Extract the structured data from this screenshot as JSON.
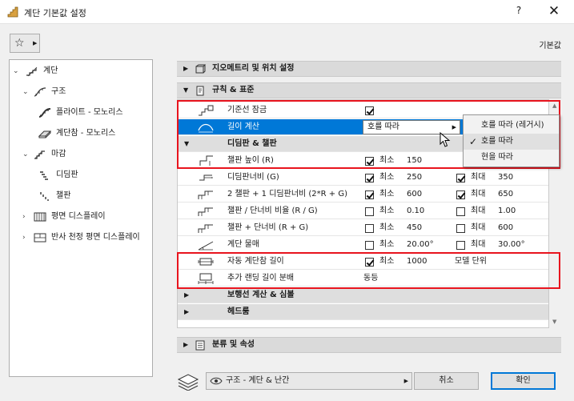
{
  "window": {
    "title": "계단 기본값 설정",
    "help": "?",
    "close": "✕"
  },
  "toolbar": {
    "default_label": "기본값"
  },
  "tree": [
    {
      "label": "계단",
      "toggle": "⌄"
    },
    {
      "label": "구조",
      "toggle": "⌄"
    },
    {
      "label": "플라이트 - 모노리스",
      "toggle": ""
    },
    {
      "label": "계단참 - 모노리스",
      "toggle": ""
    },
    {
      "label": "마감",
      "toggle": "⌄"
    },
    {
      "label": "디딤판",
      "toggle": ""
    },
    {
      "label": "챌판",
      "toggle": ""
    },
    {
      "label": "평면 디스플레이",
      "toggle": "›"
    },
    {
      "label": "반사 천정 평면 디스플레이",
      "toggle": "›"
    }
  ],
  "sections": {
    "geometry": "지오메트리 및 위치 설정",
    "rules": "규칙 & 표준",
    "classification": "분류 및 속성"
  },
  "rows": {
    "baseline_lock": {
      "name": "기준선 잠금"
    },
    "length_calc": {
      "name": "길이 계산",
      "value": "호를 따라"
    },
    "tread_riser": {
      "name": "디딤판 & 챌판"
    },
    "riser_height": {
      "name": "챌판 높이 (R)",
      "min_label": "최소",
      "min": "150"
    },
    "tread_depth": {
      "name": "디딤판너비 (G)",
      "min_label": "최소",
      "min": "250",
      "max_label": "최대",
      "max": "350"
    },
    "two_riser": {
      "name": "2 챌판 + 1 디딤판너비 (2*R + G)",
      "min_label": "최소",
      "min": "600",
      "max_label": "최대",
      "max": "650"
    },
    "ratio": {
      "name": "챌판 / 단너비 비율 (R / G)",
      "min_label": "최소",
      "min": "0.10",
      "max_label": "최대",
      "max": "1.00"
    },
    "sum": {
      "name": "챌판 + 단너비 (R + G)",
      "min_label": "최소",
      "min": "450",
      "max_label": "최대",
      "max": "600"
    },
    "slope": {
      "name": "계단 물매",
      "min_label": "최소",
      "min": "20.00°",
      "max_label": "최대",
      "max": "30.00°"
    },
    "auto_landing": {
      "name": "자동 계단참 길이",
      "min_label": "최소",
      "min": "1000",
      "extra": "모델 단위"
    },
    "extra_landing": {
      "name": "추가 랜딩 길이 분배",
      "value": "동등"
    },
    "walkline": {
      "name": "보행선 계산 & 심볼"
    },
    "headroom": {
      "name": "헤드룸"
    }
  },
  "popup": {
    "options": [
      "호를 따라 (레거시)",
      "호를 따라",
      "현을 따라"
    ],
    "selected": "호를 따라",
    "check": "✓"
  },
  "footer": {
    "layer": "구조 - 계단 & 난간",
    "cancel": "취소",
    "ok": "확인"
  },
  "colors": {
    "selection": "#0078d7",
    "highlight_box": "#e8141e"
  }
}
